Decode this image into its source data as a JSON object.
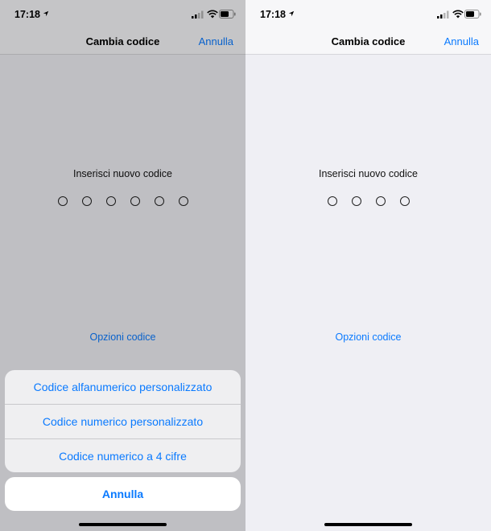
{
  "status": {
    "time": "17:18"
  },
  "nav": {
    "title": "Cambia codice",
    "cancel_label": "Annulla"
  },
  "screens": [
    {
      "prompt": "Inserisci nuovo codice",
      "digits": 6,
      "options_label": "Opzioni codice",
      "action_sheet": {
        "items": [
          "Codice alfanumerico personalizzato",
          "Codice numerico personalizzato",
          "Codice numerico a 4 cifre"
        ],
        "cancel_label": "Annulla"
      }
    },
    {
      "prompt": "Inserisci nuovo codice",
      "digits": 4,
      "options_label": "Opzioni codice"
    }
  ],
  "colors": {
    "accent": "#0a7aff",
    "background": "#efeff4"
  }
}
